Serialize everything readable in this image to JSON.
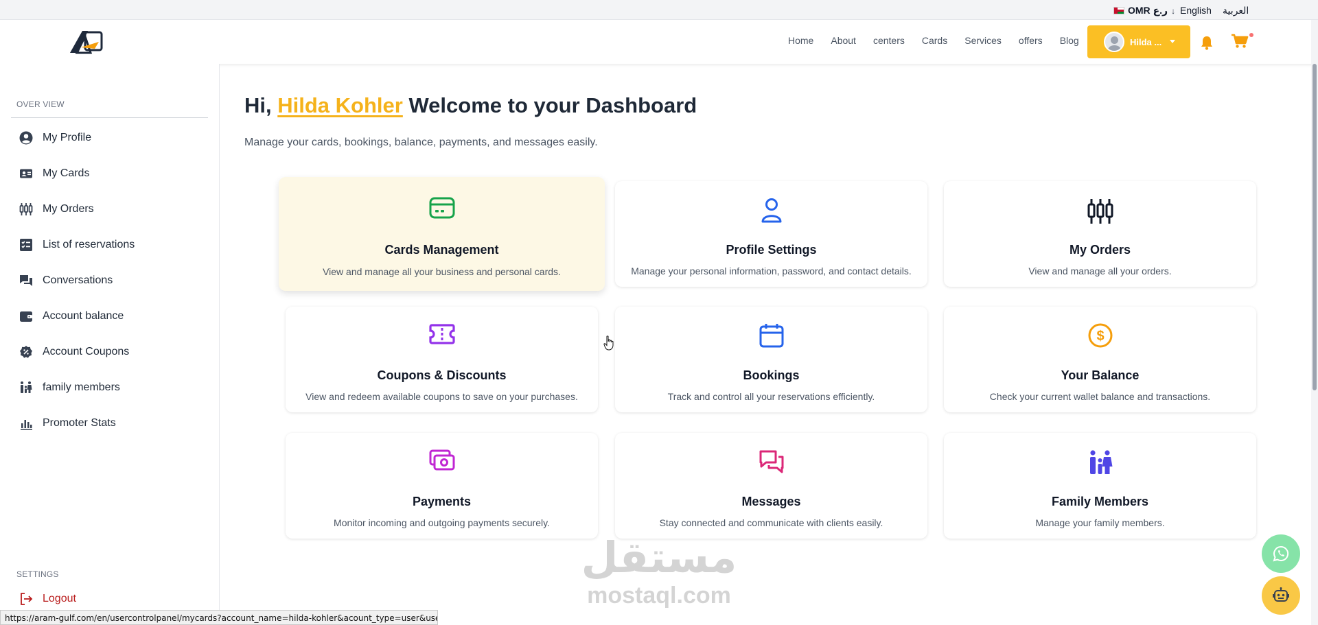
{
  "topbar": {
    "currency": "OMR ر.ع",
    "lang_en": "English",
    "lang_ar": "العربية"
  },
  "header": {
    "nav": [
      "Home",
      "About",
      "centers",
      "Cards",
      "Services",
      "offers",
      "Blog"
    ],
    "user_name": "Hilda ..."
  },
  "sidebar": {
    "overview_label": "OVER VIEW",
    "items": [
      {
        "label": "My Profile",
        "icon": "user-circle-icon"
      },
      {
        "label": "My Cards",
        "icon": "card-icon"
      },
      {
        "label": "My Orders",
        "icon": "orders-icon"
      },
      {
        "label": "List of reservations",
        "icon": "checklist-icon"
      },
      {
        "label": "Conversations",
        "icon": "chat-icon"
      },
      {
        "label": "Account balance",
        "icon": "wallet-icon"
      },
      {
        "label": "Account Coupons",
        "icon": "badge-percent-icon"
      },
      {
        "label": "family members",
        "icon": "family-icon"
      },
      {
        "label": "Promoter Stats",
        "icon": "bar-chart-icon"
      }
    ],
    "settings_label": "SETTINGS",
    "logout_label": "Logout"
  },
  "main": {
    "greeting_prefix": "Hi,",
    "user_full_name": "Hilda Kohler",
    "greeting_suffix": "Welcome to your Dashboard",
    "subtitle": "Manage your cards, bookings, balance, payments, and messages easily.",
    "cards": [
      {
        "title": "Cards Management",
        "desc": "View and manage all your business and personal cards.",
        "icon": "credit-card-icon",
        "color": "#16a34a"
      },
      {
        "title": "Profile Settings",
        "desc": "Manage your personal information, password, and contact details.",
        "icon": "user-icon",
        "color": "#2563eb"
      },
      {
        "title": "My Orders",
        "desc": "View and manage all your orders.",
        "icon": "orders-icon",
        "color": "#111827"
      },
      {
        "title": "Coupons & Discounts",
        "desc": "View and redeem available coupons to save on your purchases.",
        "icon": "ticket-icon",
        "color": "#9333ea"
      },
      {
        "title": "Bookings",
        "desc": "Track and control all your reservations efficiently.",
        "icon": "calendar-icon",
        "color": "#2563eb"
      },
      {
        "title": "Your Balance",
        "desc": "Check your current wallet balance and transactions.",
        "icon": "dollar-coin-icon",
        "color": "#f59e0b"
      },
      {
        "title": "Payments",
        "desc": "Monitor incoming and outgoing payments securely.",
        "icon": "cash-icon",
        "color": "#c026d3"
      },
      {
        "title": "Messages",
        "desc": "Stay connected and communicate with clients easily.",
        "icon": "messages-icon",
        "color": "#db2777"
      },
      {
        "title": "Family Members",
        "desc": "Manage your family members.",
        "icon": "family-icon",
        "color": "#4f46e5"
      }
    ]
  },
  "watermark": {
    "arabic": "مستقل",
    "latin": "mostaql.com"
  },
  "statusbar": {
    "url": "https://aram-gulf.com/en/usercontrolpanel/mycards?account_name=hilda-kohler&acount_type=user&userId=1&a..."
  },
  "colors": {
    "accent": "#fbbf24",
    "logout": "#b91c1c"
  }
}
